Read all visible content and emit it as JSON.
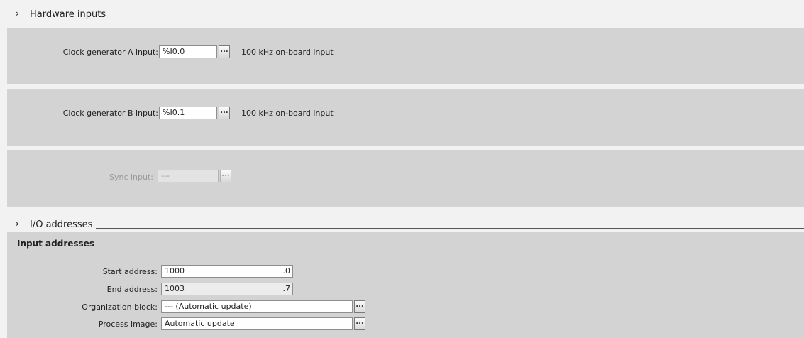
{
  "hardware_inputs": {
    "title": "Hardware inputs",
    "clock_a": {
      "label": "Clock generator A input:",
      "value": "%I0.0",
      "button": "...",
      "description": "100 kHz on-board input"
    },
    "clock_b": {
      "label": "Clock generator B input:",
      "value": "%I0.1",
      "button": "...",
      "description": "100 kHz on-board input"
    },
    "sync": {
      "label": "Sync input:",
      "value": "---",
      "button": "..."
    }
  },
  "io_addresses": {
    "title": "I/O addresses",
    "group_title": "Input addresses",
    "start_address": {
      "label": "Start address:",
      "value": "1000",
      "bit": ".0"
    },
    "end_address": {
      "label": "End address:",
      "value": "1003",
      "bit": ".7"
    },
    "organization_block": {
      "label": "Organization block:",
      "value": "--- (Automatic update)",
      "button": "..."
    },
    "process_image": {
      "label": "Process image:",
      "value": "Automatic update",
      "button": "..."
    }
  },
  "icons": {
    "section_chevron": "chevron-right-icon"
  }
}
